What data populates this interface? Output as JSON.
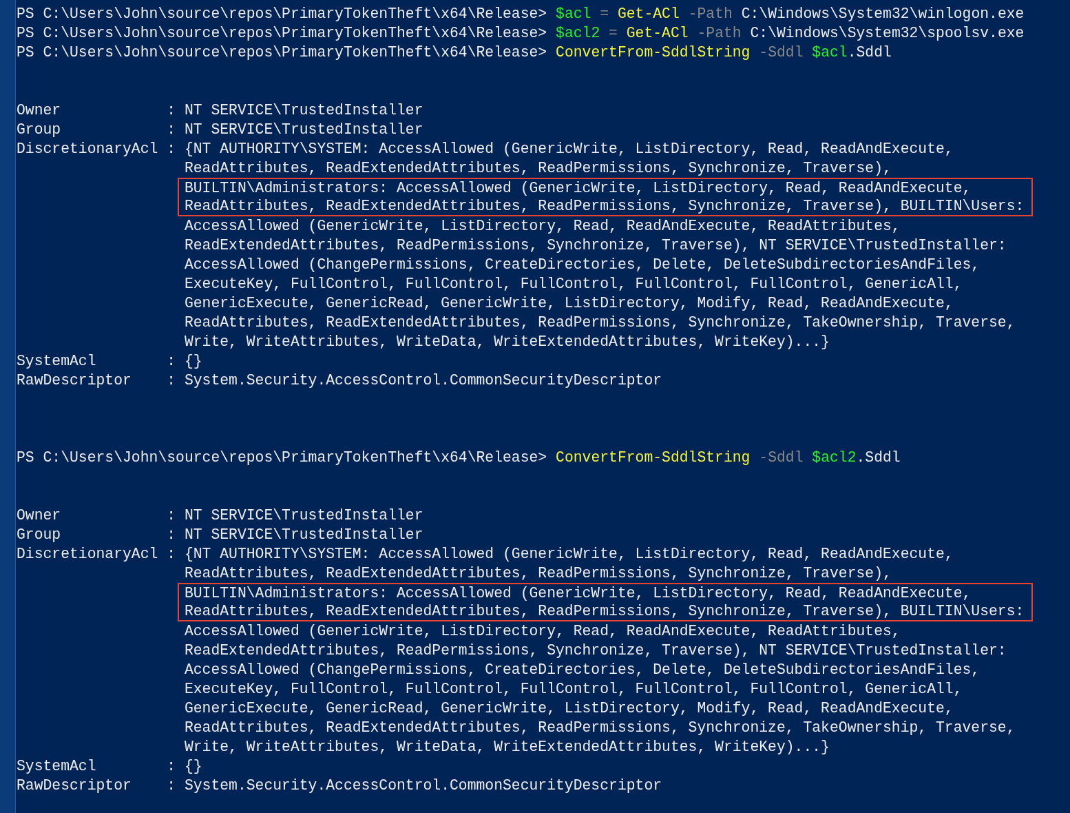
{
  "console": [
    {
      "kind": "command",
      "prompt": "PS C:\\Users\\John\\source\\repos\\PrimaryTokenTheft\\x64\\Release>",
      "tokens": [
        {
          "kind": "variable",
          "text": "$acl"
        },
        {
          "kind": "operator",
          "text": "="
        },
        {
          "kind": "cmdlet",
          "text": "Get-ACl"
        },
        {
          "kind": "parameter",
          "text": "-Path"
        },
        {
          "kind": "argument",
          "text": "C:\\Windows\\System32\\winlogon.exe"
        }
      ]
    },
    {
      "kind": "command",
      "prompt": "PS C:\\Users\\John\\source\\repos\\PrimaryTokenTheft\\x64\\Release>",
      "tokens": [
        {
          "kind": "variable",
          "text": "$acl2"
        },
        {
          "kind": "operator",
          "text": "="
        },
        {
          "kind": "cmdlet",
          "text": "Get-ACl"
        },
        {
          "kind": "parameter",
          "text": "-Path"
        },
        {
          "kind": "argument",
          "text": "C:\\Windows\\System32\\spoolsv.exe"
        }
      ]
    },
    {
      "kind": "command",
      "prompt": "PS C:\\Users\\John\\source\\repos\\PrimaryTokenTheft\\x64\\Release>",
      "tokens": [
        {
          "kind": "cmdlet",
          "text": "ConvertFrom-SddlString"
        },
        {
          "kind": "parameter",
          "text": "-Sddl"
        },
        {
          "kind": "variable",
          "text": "$acl"
        },
        {
          "kind": "member",
          "text": ".Sddl"
        }
      ]
    },
    {
      "kind": "output",
      "properties": [
        {
          "name": "Owner",
          "separator": ":",
          "value_lines": [
            {
              "text": "NT SERVICE\\TrustedInstaller",
              "highlighted": false
            }
          ]
        },
        {
          "name": "Group",
          "separator": ":",
          "value_lines": [
            {
              "text": "NT SERVICE\\TrustedInstaller",
              "highlighted": false
            }
          ]
        },
        {
          "name": "DiscretionaryAcl",
          "separator": ":",
          "value_lines": [
            {
              "text": "{NT AUTHORITY\\SYSTEM: AccessAllowed (GenericWrite, ListDirectory, Read, ReadAndExecute,",
              "highlighted": false
            },
            {
              "text": "ReadAttributes, ReadExtendedAttributes, ReadPermissions, Synchronize, Traverse),",
              "highlighted": false
            },
            {
              "text": "BUILTIN\\Administrators: AccessAllowed (GenericWrite, ListDirectory, Read, ReadAndExecute,",
              "highlighted": true
            },
            {
              "text": "ReadAttributes, ReadExtendedAttributes, ReadPermissions, Synchronize, Traverse), BUILTIN\\Users:",
              "highlighted": true
            },
            {
              "text": "AccessAllowed (GenericWrite, ListDirectory, Read, ReadAndExecute, ReadAttributes,",
              "highlighted": false
            },
            {
              "text": "ReadExtendedAttributes, ReadPermissions, Synchronize, Traverse), NT SERVICE\\TrustedInstaller:",
              "highlighted": false
            },
            {
              "text": "AccessAllowed (ChangePermissions, CreateDirectories, Delete, DeleteSubdirectoriesAndFiles,",
              "highlighted": false
            },
            {
              "text": "ExecuteKey, FullControl, FullControl, FullControl, FullControl, FullControl, GenericAll,",
              "highlighted": false
            },
            {
              "text": "GenericExecute, GenericRead, GenericWrite, ListDirectory, Modify, Read, ReadAndExecute,",
              "highlighted": false
            },
            {
              "text": "ReadAttributes, ReadExtendedAttributes, ReadPermissions, Synchronize, TakeOwnership, Traverse,",
              "highlighted": false
            },
            {
              "text": "Write, WriteAttributes, WriteData, WriteExtendedAttributes, WriteKey)...}",
              "highlighted": false
            }
          ]
        },
        {
          "name": "SystemAcl",
          "separator": ":",
          "value_lines": [
            {
              "text": "{}",
              "highlighted": false
            }
          ]
        },
        {
          "name": "RawDescriptor",
          "separator": ":",
          "value_lines": [
            {
              "text": "System.Security.AccessControl.CommonSecurityDescriptor",
              "highlighted": false
            }
          ]
        }
      ]
    },
    {
      "kind": "command",
      "prompt": "PS C:\\Users\\John\\source\\repos\\PrimaryTokenTheft\\x64\\Release>",
      "tokens": [
        {
          "kind": "cmdlet",
          "text": "ConvertFrom-SddlString"
        },
        {
          "kind": "parameter",
          "text": "-Sddl"
        },
        {
          "kind": "variable",
          "text": "$acl2"
        },
        {
          "kind": "member",
          "text": ".Sddl"
        }
      ]
    },
    {
      "kind": "output",
      "properties": [
        {
          "name": "Owner",
          "separator": ":",
          "value_lines": [
            {
              "text": "NT SERVICE\\TrustedInstaller",
              "highlighted": false
            }
          ]
        },
        {
          "name": "Group",
          "separator": ":",
          "value_lines": [
            {
              "text": "NT SERVICE\\TrustedInstaller",
              "highlighted": false
            }
          ]
        },
        {
          "name": "DiscretionaryAcl",
          "separator": ":",
          "value_lines": [
            {
              "text": "{NT AUTHORITY\\SYSTEM: AccessAllowed (GenericWrite, ListDirectory, Read, ReadAndExecute,",
              "highlighted": false
            },
            {
              "text": "ReadAttributes, ReadExtendedAttributes, ReadPermissions, Synchronize, Traverse),",
              "highlighted": false
            },
            {
              "text": "BUILTIN\\Administrators: AccessAllowed (GenericWrite, ListDirectory, Read, ReadAndExecute,",
              "highlighted": true
            },
            {
              "text": "ReadAttributes, ReadExtendedAttributes, ReadPermissions, Synchronize, Traverse), BUILTIN\\Users:",
              "highlighted": true
            },
            {
              "text": "AccessAllowed (GenericWrite, ListDirectory, Read, ReadAndExecute, ReadAttributes,",
              "highlighted": false
            },
            {
              "text": "ReadExtendedAttributes, ReadPermissions, Synchronize, Traverse), NT SERVICE\\TrustedInstaller:",
              "highlighted": false
            },
            {
              "text": "AccessAllowed (ChangePermissions, CreateDirectories, Delete, DeleteSubdirectoriesAndFiles,",
              "highlighted": false
            },
            {
              "text": "ExecuteKey, FullControl, FullControl, FullControl, FullControl, FullControl, GenericAll,",
              "highlighted": false
            },
            {
              "text": "GenericExecute, GenericRead, GenericWrite, ListDirectory, Modify, Read, ReadAndExecute,",
              "highlighted": false
            },
            {
              "text": "ReadAttributes, ReadExtendedAttributes, ReadPermissions, Synchronize, TakeOwnership, Traverse,",
              "highlighted": false
            },
            {
              "text": "Write, WriteAttributes, WriteData, WriteExtendedAttributes, WriteKey)...}",
              "highlighted": false
            }
          ]
        },
        {
          "name": "SystemAcl",
          "separator": ":",
          "value_lines": [
            {
              "text": "{}",
              "highlighted": false
            }
          ]
        },
        {
          "name": "RawDescriptor",
          "separator": ":",
          "value_lines": [
            {
              "text": "System.Security.AccessControl.CommonSecurityDescriptor",
              "highlighted": false
            }
          ]
        }
      ]
    }
  ]
}
